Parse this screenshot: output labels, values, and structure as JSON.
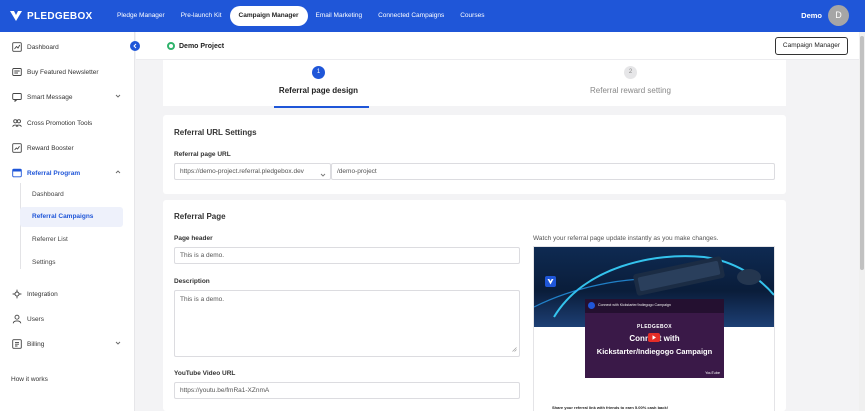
{
  "brand": {
    "name": "PLEDGEBOX"
  },
  "nav": {
    "items": [
      {
        "label": "Pledge Manager",
        "active": false
      },
      {
        "label": "Pre-launch Kit",
        "active": false
      },
      {
        "label": "Campaign Manager",
        "active": true
      },
      {
        "label": "Email Marketing",
        "active": false
      },
      {
        "label": "Connected Campaigns",
        "active": false
      },
      {
        "label": "Courses",
        "active": false
      }
    ],
    "user_name": "Demo",
    "avatar_initial": "D"
  },
  "sidebar": {
    "items": [
      {
        "label": "Dashboard",
        "icon": "dashboard-icon"
      },
      {
        "label": "Buy Featured Newsletter",
        "icon": "newsletter-icon"
      },
      {
        "label": "Smart Message",
        "icon": "message-icon"
      },
      {
        "label": "Cross Promotion Tools",
        "icon": "people-icon"
      },
      {
        "label": "Reward Booster",
        "icon": "booster-icon"
      },
      {
        "label": "Referral Program",
        "icon": "referral-icon"
      }
    ],
    "referral_sub": [
      {
        "label": "Dashboard",
        "active": false
      },
      {
        "label": "Referral Campaigns",
        "active": true
      },
      {
        "label": "Referrer List",
        "active": false
      },
      {
        "label": "Settings",
        "active": false
      }
    ],
    "bottom_items": [
      {
        "label": "Integration",
        "icon": "integration-icon"
      },
      {
        "label": "Users",
        "icon": "user-icon"
      },
      {
        "label": "Billing",
        "icon": "billing-icon"
      }
    ],
    "how_it_works": "How it works"
  },
  "header": {
    "project_name": "Demo Project",
    "campaign_manager_button": "Campaign Manager"
  },
  "stepper": {
    "steps": [
      {
        "number": "1",
        "label": "Referral page design",
        "active": true
      },
      {
        "number": "2",
        "label": "Referral reward setting",
        "active": false
      }
    ]
  },
  "url_settings": {
    "title": "Referral URL Settings",
    "field_label": "Referral page URL",
    "domain_value": "https://demo-project.referral.pledgebox.dev",
    "path_value": "/demo-project"
  },
  "referral_page": {
    "title": "Referral Page",
    "header_label": "Page header",
    "header_value": "This is a demo.",
    "description_label": "Description",
    "description_value": "This is a demo.",
    "youtube_label": "YouTube Video URL",
    "youtube_value": "https://youtu.be/fmRa1-XZnmA",
    "preview_note": "Watch your referral page update instantly as you make changes.",
    "preview": {
      "video_title": "Connect with Kickstarter/Indiegogo Campaign",
      "video_brand": "PLEDGEBOX",
      "video_line1": "Connect with",
      "video_line2": "Kickstarter/Indiegogo Campaign",
      "youtube_mark": "YouTube",
      "share_text": "Share your referral link with friends to earn 5.00% cash back!"
    }
  },
  "colors": {
    "primary": "#1f56d8",
    "active_bg": "#eef1fb",
    "success": "#2fb36b"
  }
}
